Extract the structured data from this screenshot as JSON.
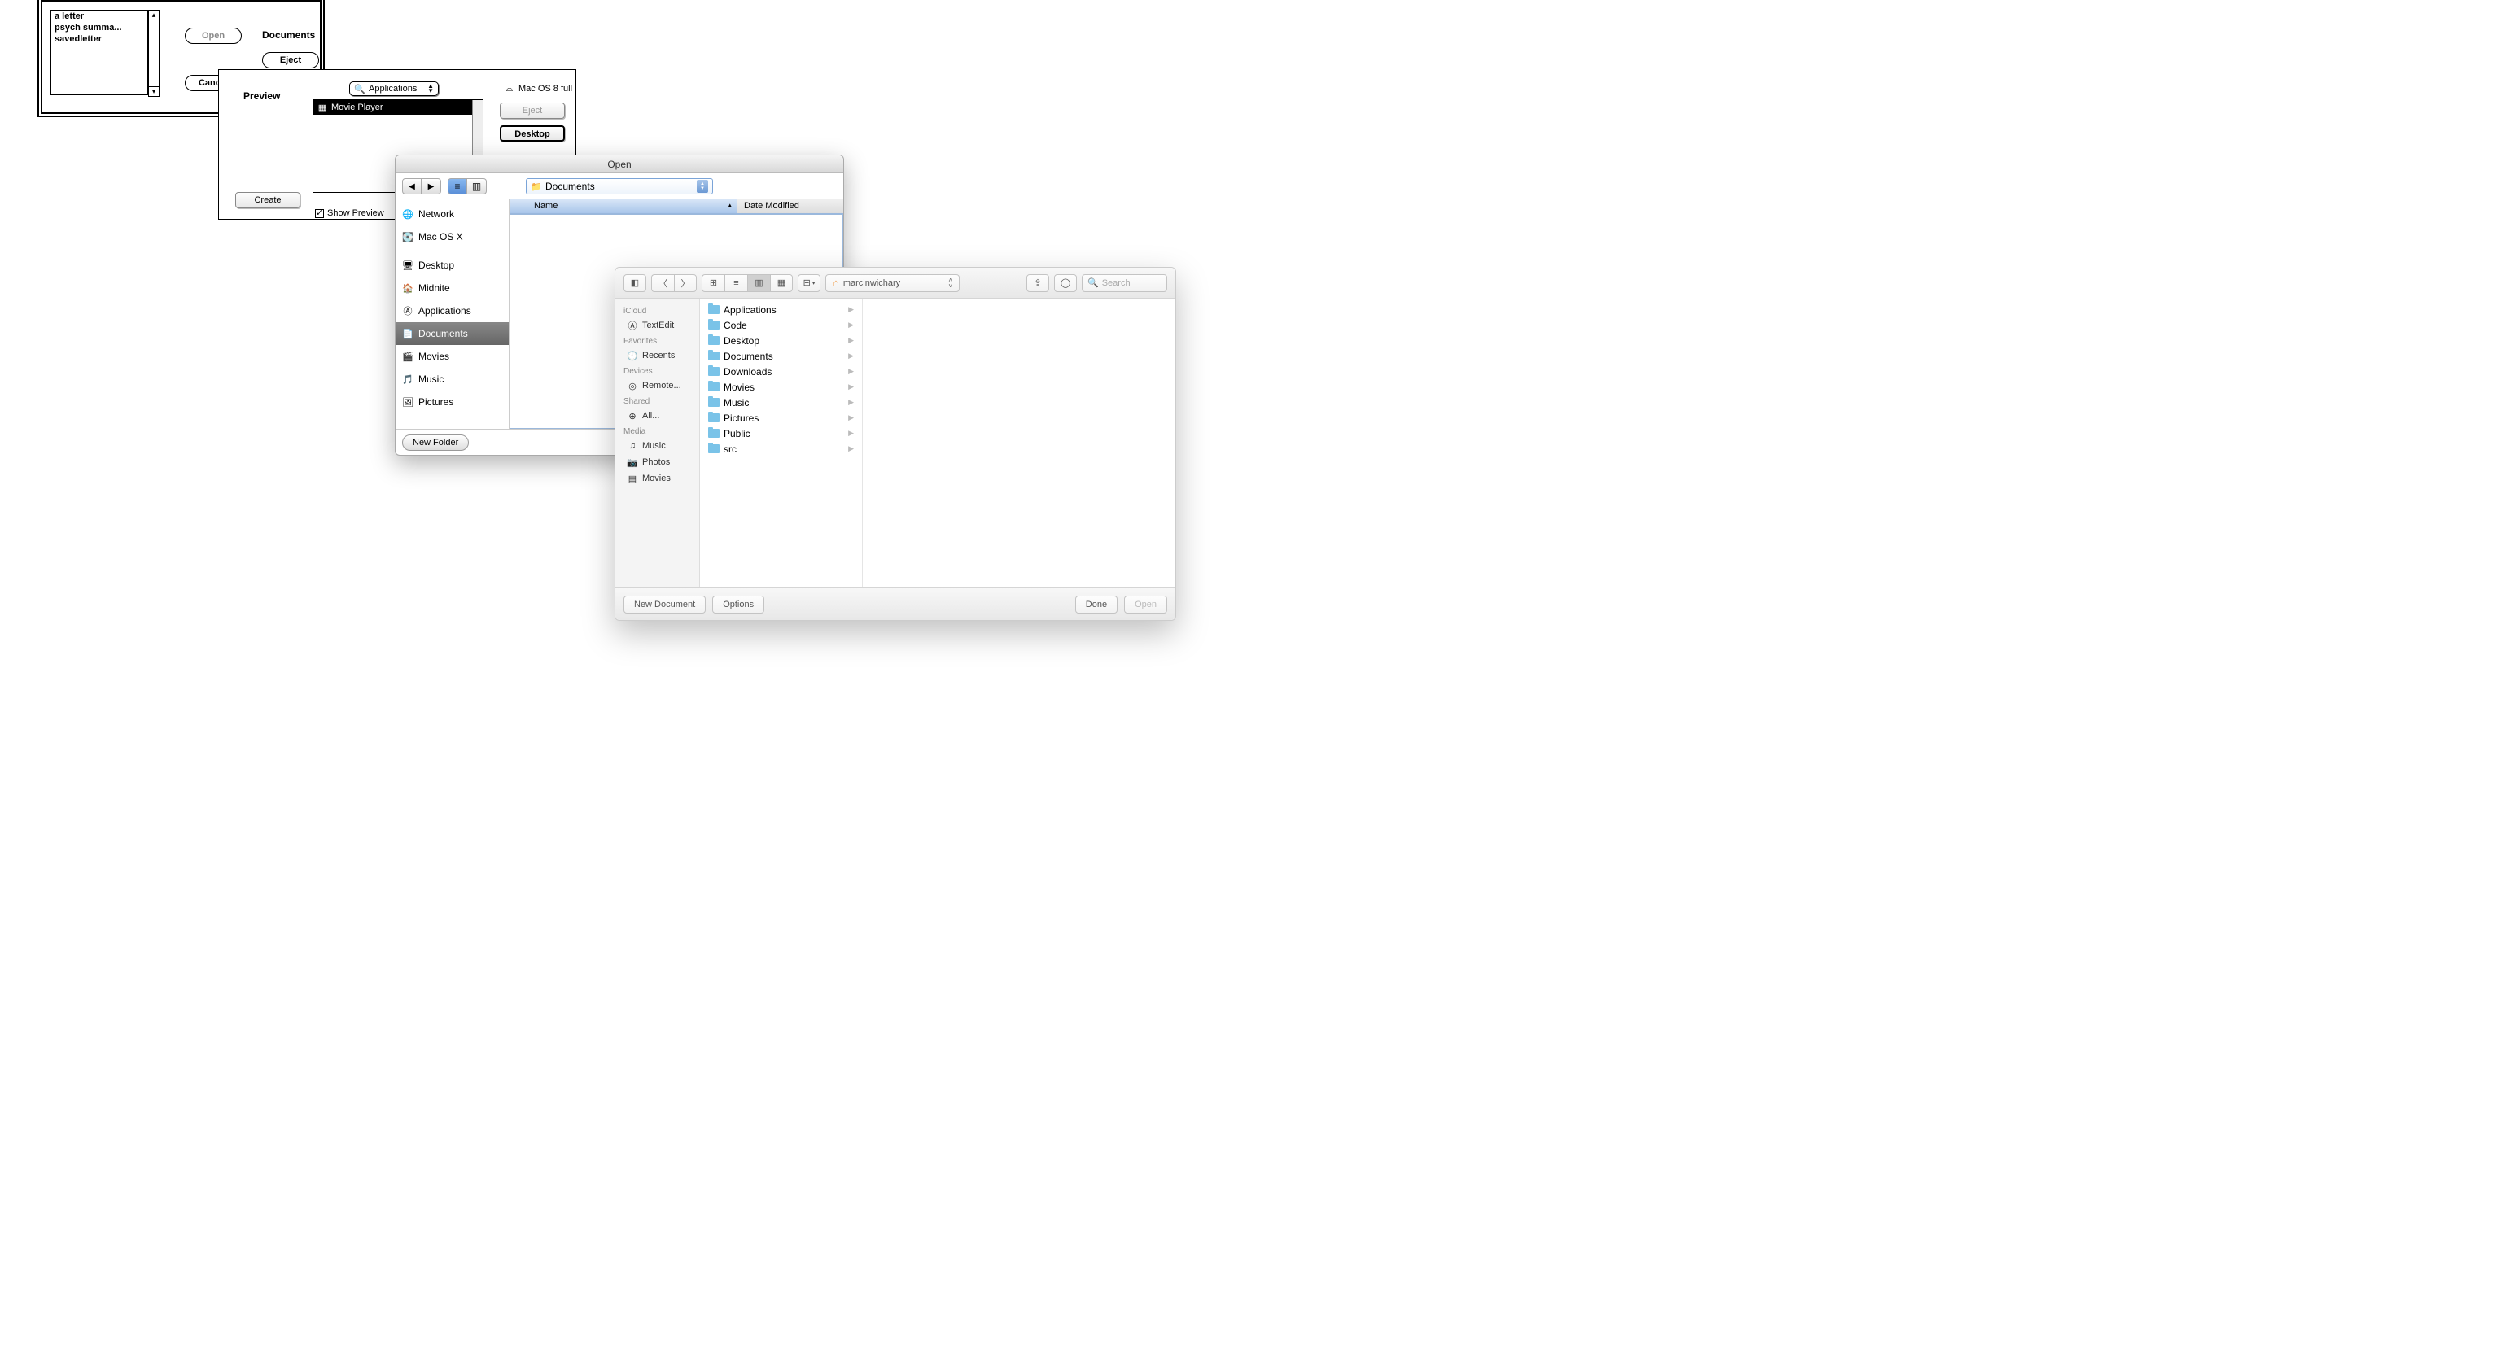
{
  "d1": {
    "files": [
      "a letter",
      "psych summa...",
      "savedletter"
    ],
    "open": "Open",
    "eject": "Eject",
    "cancel": "Cancel",
    "location": "Documents"
  },
  "d2": {
    "preview_label": "Preview",
    "popup": "Applications",
    "list_selected": "Movie Player",
    "disk": "Mac OS 8 full",
    "eject": "Eject",
    "desktop": "Desktop",
    "create": "Create",
    "show_preview": "Show Preview"
  },
  "d3": {
    "title": "Open",
    "location": "Documents",
    "col_name": "Name",
    "col_date": "Date Modified",
    "sidebar": {
      "network": "Network",
      "disk": "Mac OS X",
      "desktop": "Desktop",
      "home": "Midnite",
      "apps": "Applications",
      "docs": "Documents",
      "movies": "Movies",
      "music": "Music",
      "pictures": "Pictures"
    },
    "new_folder": "New Folder"
  },
  "d4": {
    "location": "marcinwichary",
    "search_placeholder": "Search",
    "sidebar": {
      "icloud_head": "iCloud",
      "textedit": "TextEdit",
      "favorites_head": "Favorites",
      "recents": "Recents",
      "devices_head": "Devices",
      "remote": "Remote...",
      "shared_head": "Shared",
      "all": "All...",
      "media_head": "Media",
      "music": "Music",
      "photos": "Photos",
      "movies": "Movies"
    },
    "folders": [
      "Applications",
      "Code",
      "Desktop",
      "Documents",
      "Downloads",
      "Movies",
      "Music",
      "Pictures",
      "Public",
      "src"
    ],
    "new_document": "New Document",
    "options": "Options",
    "done": "Done",
    "open": "Open"
  }
}
